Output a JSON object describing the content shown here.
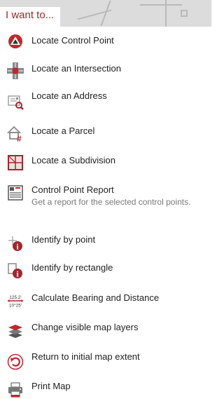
{
  "header": {
    "title": "I want to..."
  },
  "colors": {
    "accent": "#a4262c",
    "icon_gray": "#777777",
    "header_bg": "#dcdcdc"
  },
  "menu": {
    "items": [
      {
        "label": "Locate Control Point",
        "icon": "control-point-icon"
      },
      {
        "label": "Locate an Intersection",
        "icon": "intersection-icon"
      },
      {
        "label": "Locate an Address",
        "icon": "address-search-icon"
      },
      {
        "label": "Locate a Parcel",
        "icon": "parcel-icon"
      },
      {
        "label": "Locate a Subdivision",
        "icon": "subdivision-icon"
      },
      {
        "label": "Control Point Report",
        "description": "Get a report for the selected control points.",
        "icon": "report-icon"
      },
      {
        "label": "Identify by point",
        "icon": "identify-point-icon"
      },
      {
        "label": "Identify by rectangle",
        "icon": "identify-rectangle-icon"
      },
      {
        "label": "Calculate Bearing and Distance",
        "icon": "bearing-distance-icon",
        "icon_text_top": "125.2'",
        "icon_text_bottom": "10°25'"
      },
      {
        "label": "Change visible map layers",
        "icon": "layers-icon"
      },
      {
        "label": "Return to initial map extent",
        "icon": "return-extent-icon"
      },
      {
        "label": "Print Map",
        "icon": "printer-icon"
      }
    ]
  }
}
